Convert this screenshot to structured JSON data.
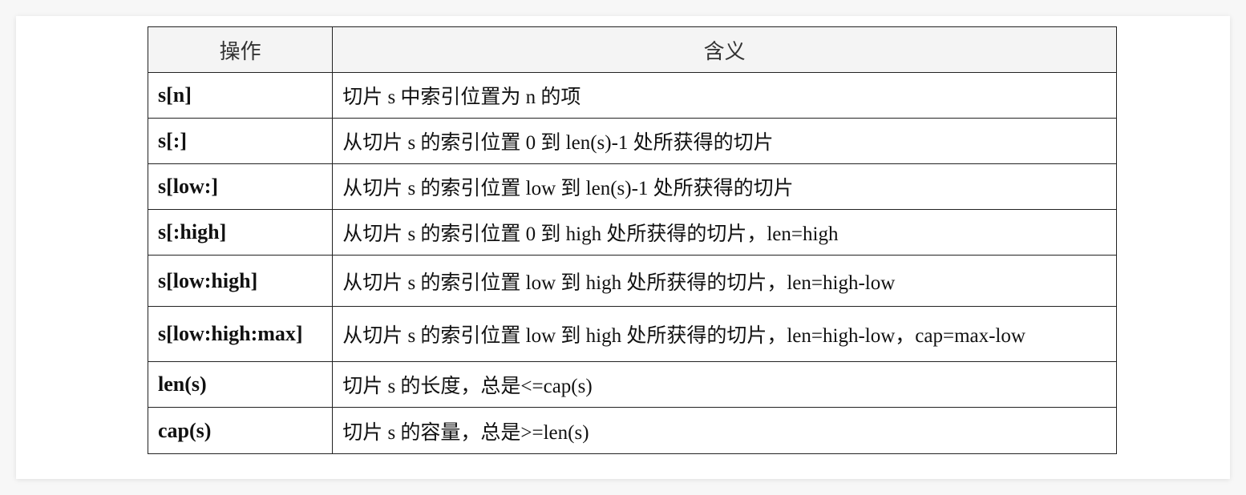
{
  "table": {
    "headers": [
      "操作",
      "含义"
    ],
    "rows": [
      {
        "op": "s[n]",
        "meaning": "切片 s 中索引位置为 n 的项"
      },
      {
        "op": "s[:]",
        "meaning": "从切片 s 的索引位置 0 到 len(s)-1 处所获得的切片"
      },
      {
        "op": "s[low:]",
        "meaning": "从切片 s 的索引位置 low 到 len(s)-1 处所获得的切片"
      },
      {
        "op": "s[:high]",
        "meaning": "从切片 s 的索引位置 0 到 high 处所获得的切片，len=high"
      },
      {
        "op": "s[low:high]",
        "meaning": "从切片 s 的索引位置 low 到 high 处所获得的切片，len=high-low"
      },
      {
        "op": "s[low:high:max]",
        "meaning": "从切片 s 的索引位置 low 到 high 处所获得的切片，len=high-low，cap=max-low"
      },
      {
        "op": "len(s)",
        "meaning": "切片 s 的长度，总是<=cap(s)"
      },
      {
        "op": "cap(s)",
        "meaning": "切片 s 的容量，总是>=len(s)"
      }
    ]
  }
}
